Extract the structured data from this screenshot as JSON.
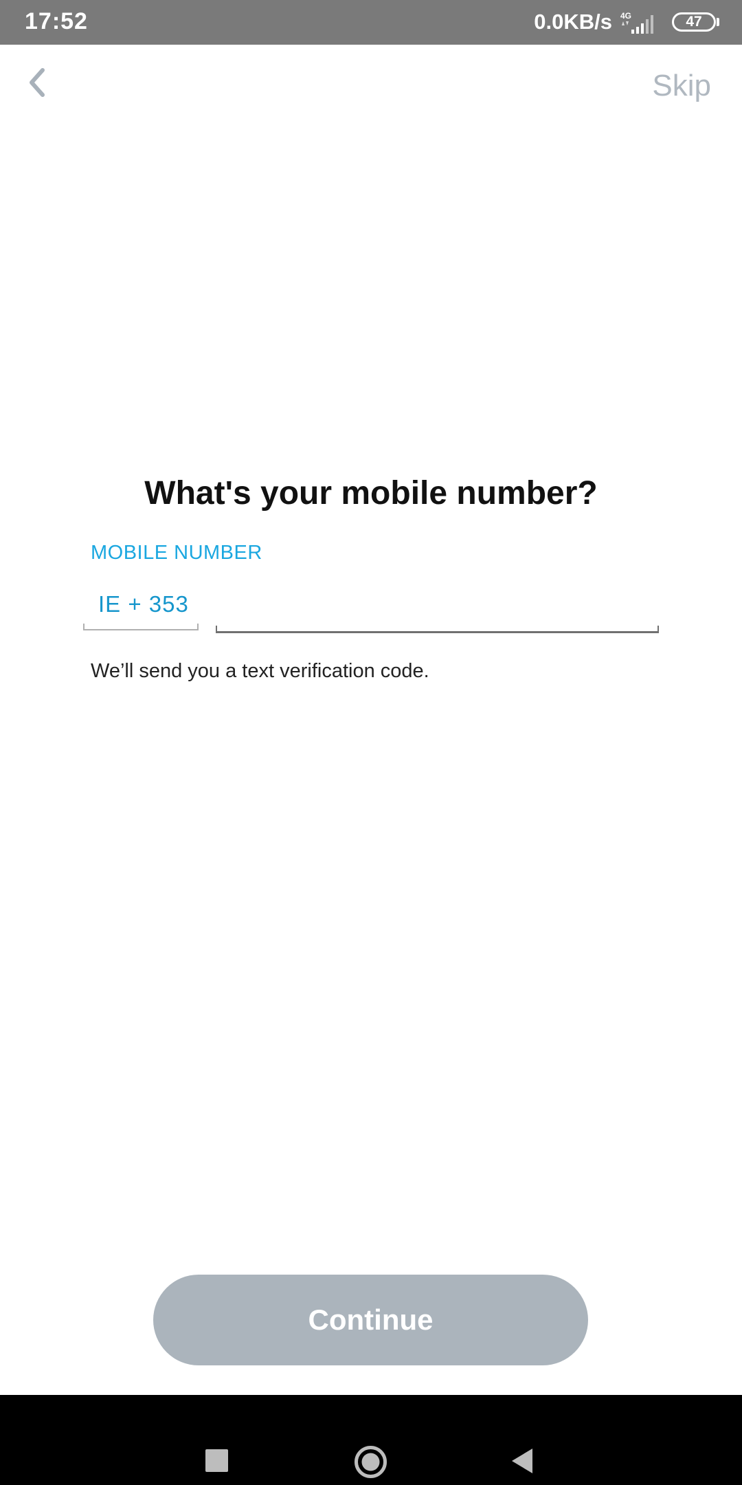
{
  "status_bar": {
    "time": "17:52",
    "network_speed": "0.0KB/s",
    "network_type": "4G",
    "battery": "47"
  },
  "nav": {
    "back_icon": "chevron-left-icon",
    "skip_label": "Skip"
  },
  "main": {
    "title": "What's your mobile number?",
    "field_label": "MOBILE NUMBER",
    "country_code": "IE + 353",
    "phone_value": "",
    "phone_placeholder": "",
    "helper_text": "We’ll send you a text verification code."
  },
  "footer": {
    "continue_label": "Continue"
  },
  "system_nav": {
    "recents_icon": "square-icon",
    "home_icon": "circle-icon",
    "back_icon": "triangle-back-icon"
  },
  "colors": {
    "accent": "#1aa7e0",
    "button_disabled": "#abb4bc",
    "status_bar": "#7a7a7a",
    "skip": "#b0b8c0"
  }
}
